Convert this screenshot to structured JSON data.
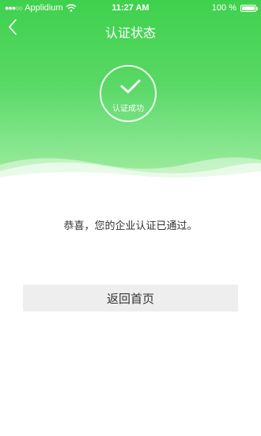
{
  "status_bar": {
    "signal_dots": "●●●○○",
    "carrier": "Applidium",
    "time": "11:27 AM",
    "battery": "100 %"
  },
  "nav": {
    "back_icon": "chevron-left-icon",
    "title": "认证状态"
  },
  "badge": {
    "icon": "check-icon",
    "label": "认证成功"
  },
  "message": "恭喜，您的企业认证已通过。",
  "home_button": {
    "label": "返回首页"
  },
  "colors": {
    "header_green": "#3fd14d",
    "header_green_light": "#a6ec9f",
    "button_bg": "#eeeeee",
    "text": "#333333"
  }
}
